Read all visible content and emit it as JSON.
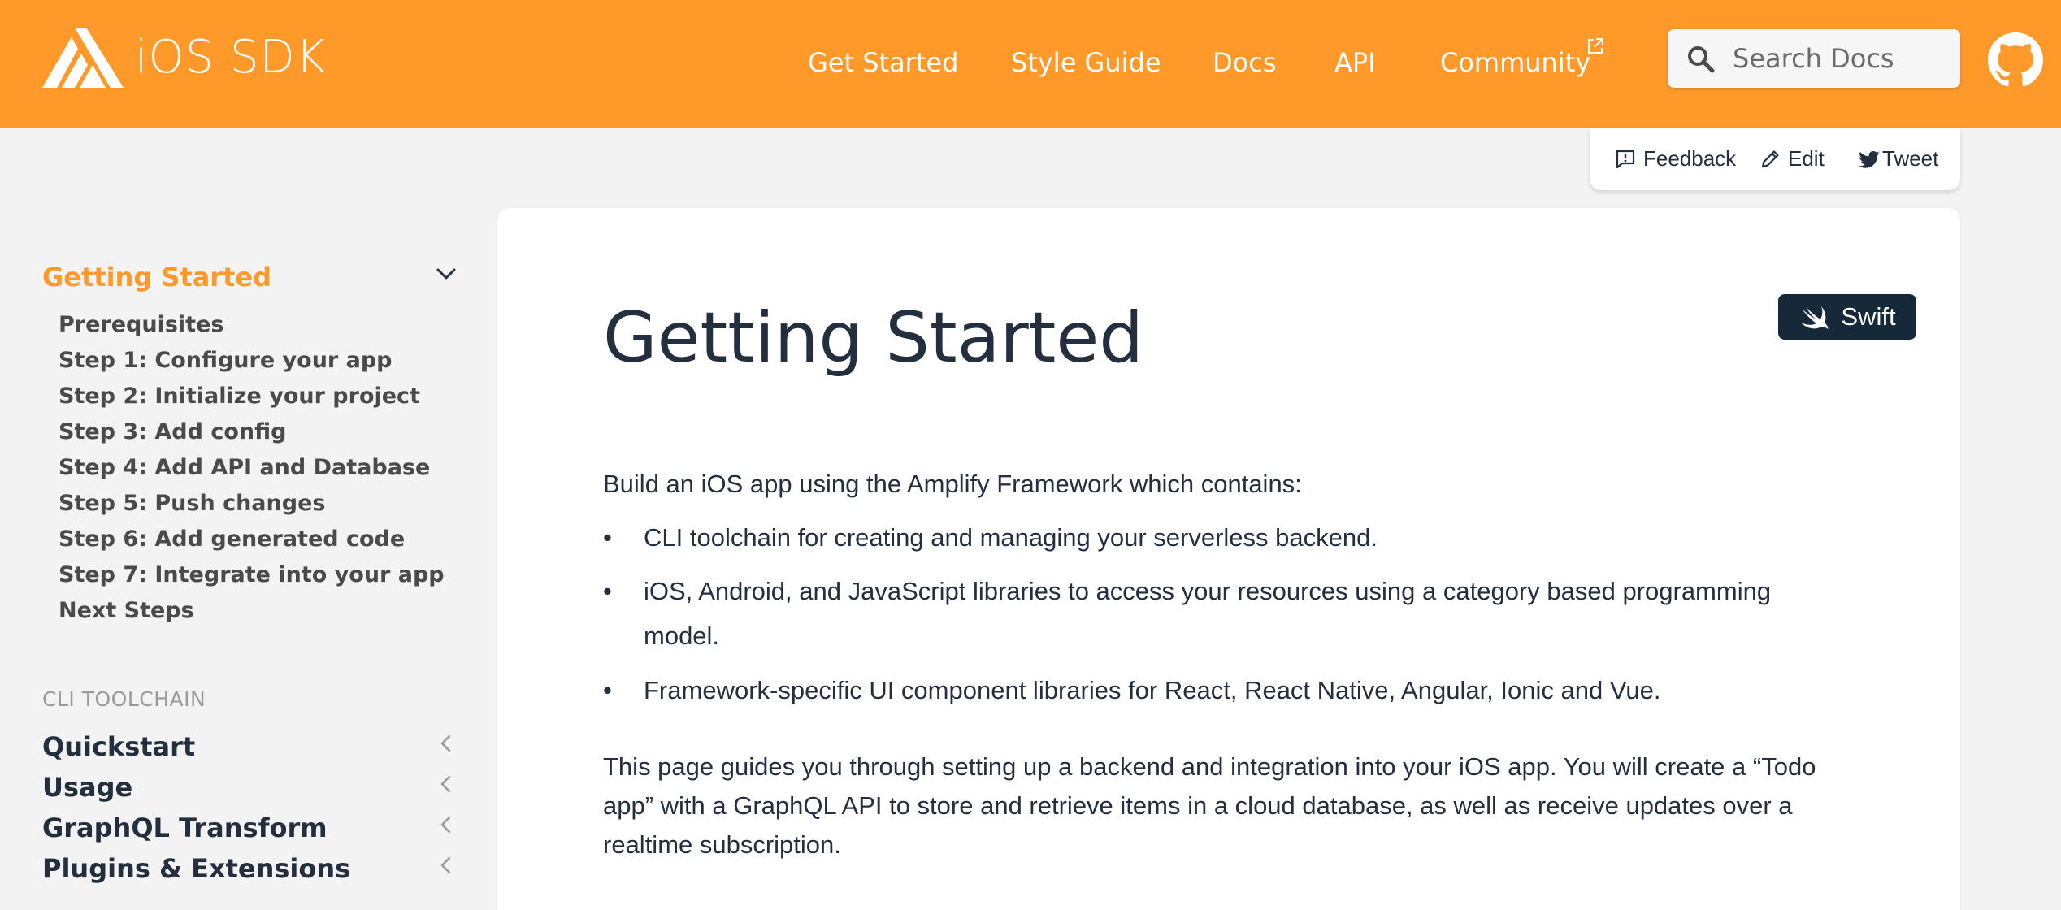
{
  "header": {
    "brand": "iOS SDK",
    "nav": [
      "Get Started",
      "Style Guide",
      "Docs",
      "API",
      "Community"
    ],
    "search_placeholder": "Search Docs",
    "brand_color": "#ff9a2a"
  },
  "feedback": {
    "feedback_label": "Feedback",
    "edit_label": "Edit",
    "tweet_label": "Tweet"
  },
  "sidebar": {
    "section_title": "Getting Started",
    "items": [
      "Prerequisites",
      "Step 1: Configure your app",
      "Step 2: Initialize your project",
      "Step 3: Add config",
      "Step 4: Add API and Database",
      "Step 5: Push changes",
      "Step 6: Add generated code",
      "Step 7: Integrate into your app",
      "Next Steps"
    ],
    "category": "CLI TOOLCHAIN",
    "groups": [
      "Quickstart",
      "Usage",
      "GraphQL Transform",
      "Plugins & Extensions"
    ]
  },
  "main": {
    "title": "Getting Started",
    "platform_badge": "Swift",
    "intro": "Build an iOS app using the Amplify Framework which contains:",
    "bullets": [
      "CLI toolchain for creating and managing your serverless backend.",
      "iOS, Android, and JavaScript libraries to access your resources using a category based programming model.",
      "Framework-specific UI component libraries for React, React Native, Angular, Ionic and Vue."
    ],
    "guide_text": "This page guides you through setting up a backend and integration into your iOS app. You will create a “Todo app” with a GraphQL API to store and retrieve items in a cloud database, as well as receive updates over a realtime subscription."
  }
}
